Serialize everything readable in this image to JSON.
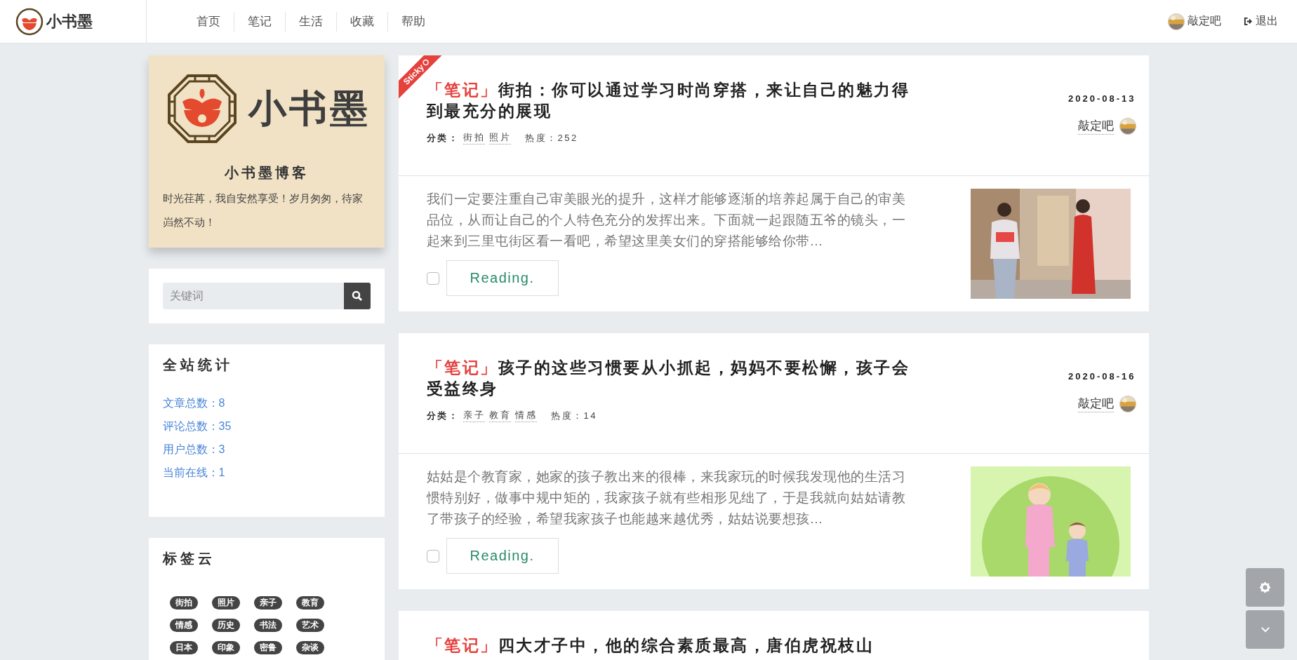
{
  "header": {
    "logo_text": "小书墨",
    "nav": [
      {
        "label": "首页"
      },
      {
        "label": "笔记"
      },
      {
        "label": "生活"
      },
      {
        "label": "收藏"
      },
      {
        "label": "帮助"
      }
    ],
    "user": "敲定吧",
    "logout": "退出"
  },
  "profile": {
    "logo_text": "小书墨",
    "title": "小书墨博客",
    "motto": "时光荏苒，我自安然享受！岁月匆匆，待家岿然不动！"
  },
  "search": {
    "placeholder": "关键词"
  },
  "stats": {
    "title": "全站统计",
    "items": [
      "文章总数：8",
      "评论总数：35",
      "用户总数：3",
      "当前在线：1"
    ]
  },
  "tag_cloud": {
    "title": "标签云",
    "tags": [
      "街拍",
      "照片",
      "亲子",
      "教育",
      "情感",
      "历史",
      "书法",
      "艺术",
      "日本",
      "印象",
      "密鲁",
      "杂谈"
    ]
  },
  "posts": [
    {
      "sticky": true,
      "sticky_label": "Sticky",
      "category": "「笔记」",
      "title": "街拍：你可以通过学习时尚穿搭，来让自己的魅力得到最充分的展现",
      "meta_label": "分类：",
      "tags": [
        "街拍",
        "照片"
      ],
      "heat": "热度：252",
      "date": "2020-08-13",
      "author": "敲定吧",
      "excerpt": "我们一定要注重自己审美眼光的提升，这样才能够逐渐的培养起属于自己的审美品位，从而让自己的个人特色充分的发挥出来。下面就一起跟随五爷的镜头，一起来到三里屯街区看一看吧，希望这里美女们的穿搭能够给你带…",
      "checked": false,
      "button": "Reading.",
      "thumbnail": {
        "kind": "picture"
      }
    },
    {
      "sticky": false,
      "category": "「笔记」",
      "title": "孩子的这些习惯要从小抓起，妈妈不要松懈，孩子会受益终身",
      "meta_label": "分类：",
      "tags": [
        "亲子",
        "教育",
        "情感"
      ],
      "heat": "热度：14",
      "date": "2020-08-16",
      "author": "敲定吧",
      "excerpt": "姑姑是个教育家，她家的孩子教出来的很棒，来我家玩的时候我发现他的生活习惯特别好，做事中规中矩的，我家孩子就有些相形见绌了，于是我就向姑姑请教了带孩子的经验，希望我家孩子也能越来越优秀，姑姑说要想孩…",
      "checked": false,
      "button": "Reading.",
      "thumbnail": {
        "kind": "picture"
      }
    },
    {
      "sticky": false,
      "category": "「笔记」",
      "title": "四大才子中，他的综合素质最高，唐伯虎祝枝山"
    }
  ]
}
